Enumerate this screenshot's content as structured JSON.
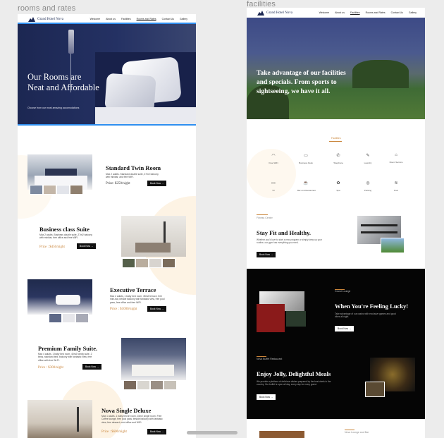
{
  "frames": {
    "left_label": "rooms and rates",
    "right_label": "facilities"
  },
  "brand": "Grand Hotel Nova",
  "nav_left": [
    "Welcome",
    "About us",
    "Facilities",
    "Rooms and Rates",
    "Contact Us",
    "Gallery"
  ],
  "nav_left_active": "Rooms and Rates",
  "nav_right": [
    "Welcome",
    "About us",
    "Facilities",
    "Rooms and Rates",
    "Contact Us",
    "Gallery"
  ],
  "nav_right_active": "Facilities",
  "rooms_page": {
    "hero_title": "Our Rooms are\nNeat and Affordable",
    "hero_sub": "Choose from our most amazing accomodations",
    "rooms": [
      {
        "title": "Standard Twin Room",
        "desc": "Max 2 adults. Standard double suite, 27m2 balcony with minibar, and free WiFi.",
        "price": "Price: $250/night",
        "cta": "Book Now  →"
      },
      {
        "title": "Business class Suite",
        "desc": "Max 2 adults. Business double suite, 27m2 balcony with minibar, free office and free WiFi.",
        "price": "Price : $450/night",
        "cta": "Book Now  →"
      },
      {
        "title": "Executive Terrace",
        "desc": "Max 2 adults, 1 baby bed room, 35m2 terrace, free mini-bar, beside balcony with fantastic view, free pool pass, free office and free WiFi.",
        "price": "Price : $1000/night",
        "cta": "Book Now  →"
      },
      {
        "title": "Premium Family Suite.",
        "desc": "Max 4 adults, 1 baby bed room, 40m2 family suite, 2 beds, standard bed, balcony with fantastic view, free office with free Wi-Fi.",
        "price": "Price : $300/night",
        "cta": "Book Now  →"
      },
      {
        "title": "Nova Single Deluxe",
        "desc": "Max 1 adults, 1 baby bed in room, 15m2 single room. Free Coffee lounge, free pool pass, beside balcony with fantastic view, free dessert, mini-office and WiFi.",
        "price": "Price : $600/night",
        "cta": "Book Now  →"
      }
    ]
  },
  "facilities_page": {
    "hero_title": "Take advantage of our facilities\nand specials. From sports to\nsightseeing, we have it all.",
    "section_label": "Facilities",
    "icons": [
      {
        "icon": "wifi-icon",
        "label": "Free WiFi"
      },
      {
        "icon": "desk-icon",
        "label": "Business Desk"
      },
      {
        "icon": "phone-icon",
        "label": "Telephone"
      },
      {
        "icon": "laundry-icon",
        "label": "Laundry"
      },
      {
        "icon": "room-service-icon",
        "label": "Room Service"
      },
      {
        "icon": "tv-icon",
        "label": "TV"
      },
      {
        "icon": "cafe-icon",
        "label": "Bar and Restaurant"
      },
      {
        "icon": "spa-icon",
        "label": "Spa"
      },
      {
        "icon": "parking-icon",
        "label": "Parking"
      },
      {
        "icon": "pool-icon",
        "label": "Pool"
      }
    ],
    "fitness": {
      "label": "Fitness Center",
      "title": "Stay Fit and Healthy.",
      "body": "Whether you'd love to start a new program or simply keep up your routine, our gym has everything you need.",
      "cta": "Book Now  →"
    },
    "casino": {
      "label": "Grand Lounge",
      "title": "When You're Feeling Lucky!",
      "body": "Take advantage of our casino with exclusive games and good vibes all night.",
      "cta": "Book Now  →"
    },
    "dining": {
      "label": "Nova Buffet Restaurant",
      "title": "Enjoy Jolly, Delightful Meals",
      "body": "We provide a plethora of delicious dishes prepared by the best chefs in the country. Our buffet is open all day, every day for every guest.",
      "cta": "Book Now  →"
    },
    "footer_label": "Nova Lounge and Bar"
  },
  "colors": {
    "navy": "#1c2752",
    "accent": "#c9853a",
    "selection": "#2f8ff0",
    "cream": "#fdf3e4"
  }
}
